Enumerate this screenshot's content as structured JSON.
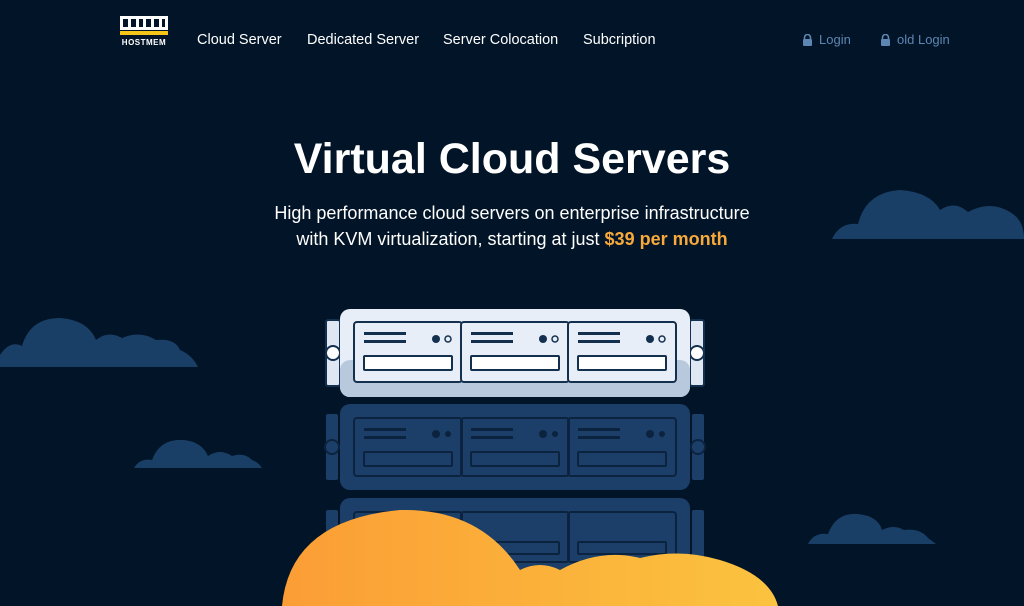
{
  "brand": {
    "name": "HOSTMEM"
  },
  "nav": {
    "items": [
      "Cloud Server",
      "Dedicated Server",
      "Server Colocation",
      "Subcription"
    ]
  },
  "auth": {
    "login_label": "Login",
    "old_login_label": "old Login",
    "icon": "lock-icon"
  },
  "hero": {
    "title": "Virtual Cloud Servers",
    "subtitle_line1": "High performance cloud servers on enterprise infrastructure",
    "subtitle_line2": "with KVM virtualization, starting at just",
    "price": "$39 per month"
  },
  "colors": {
    "background": "#021427",
    "cloud_dark": "#1a3f66",
    "server_dark": "#1c3f69",
    "server_light": "#e8eef7",
    "accent_orange": "#f7a93b",
    "auth_link": "#5d86b3"
  }
}
